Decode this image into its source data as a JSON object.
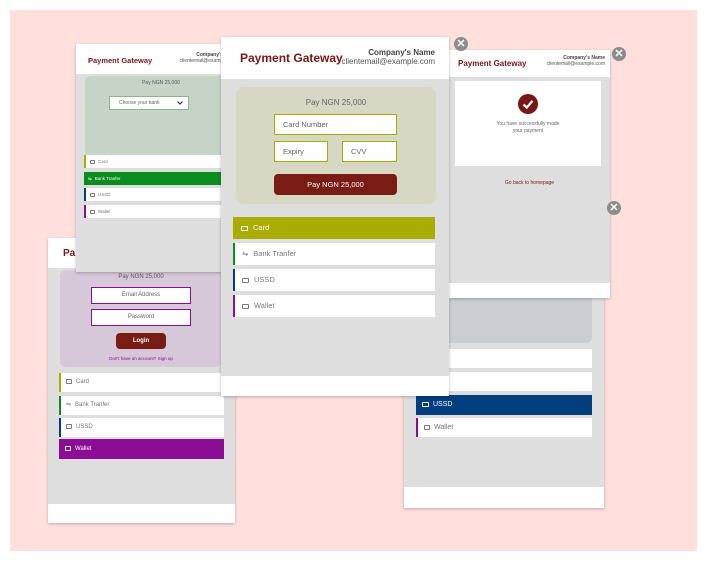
{
  "header": {
    "title": "Payment Gateway",
    "company_name": "Company's Name",
    "company_email": "clientemail@example.com"
  },
  "amount_label": "Pay NGN 25,000",
  "bank_select": {
    "placeholder": "Choose your bank"
  },
  "card_form": {
    "number_placeholder": "Card Number",
    "expiry_placeholder": "Expiry",
    "cvv_placeholder": "CVV",
    "pay_label": "Pay NGN 25,000"
  },
  "login_form": {
    "email_placeholder": "Email Address",
    "password_placeholder": "Password",
    "login_label": "Login",
    "signup_prompt": "Don't have an account? Sign up"
  },
  "methods": [
    "Card",
    "Bank Tranfer",
    "USSD",
    "Wallet"
  ],
  "success": {
    "message": "You have successfully made your payment",
    "back_link": "Go back to homepage"
  },
  "partial": {
    "title_fragment": "Pa",
    "tranfer_fragment": "ranfer"
  },
  "icons": {
    "close": "close-icon",
    "card": "card-icon",
    "bank": "bank-icon",
    "ussd": "ussd-icon",
    "wallet": "wallet-icon",
    "check": "check-icon",
    "chevron": "chevron-down-icon"
  },
  "colors": {
    "background": "#ffe0dd",
    "brand": "#7a1616",
    "pay_button": "#781c14",
    "card": "#a9ad00",
    "bank": "#0a8c1e",
    "ussd": "#003e7e",
    "wallet": "#8b0d96"
  }
}
